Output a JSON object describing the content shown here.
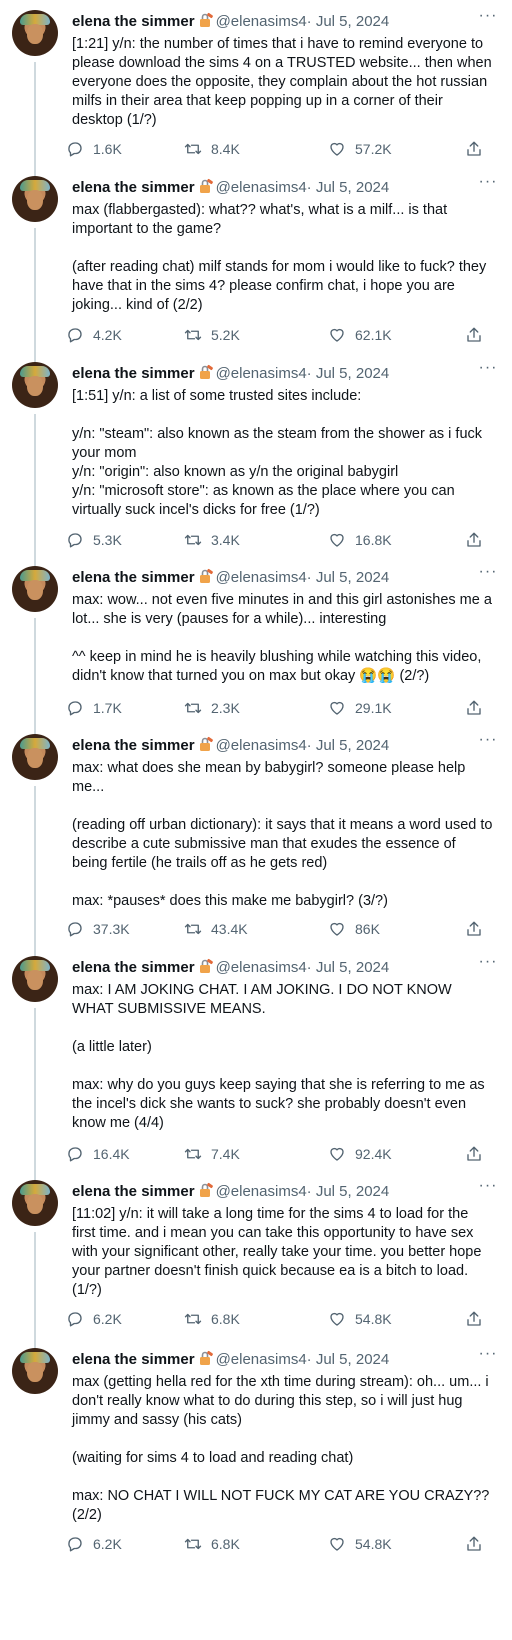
{
  "tweets": [
    {
      "name": "elena the simmer",
      "handle": "@elenasims4",
      "date": "· Jul 5, 2024",
      "text": "[1:21] y/n: the number of times that i have to remind everyone to please download the sims 4 on a TRUSTED website... then when everyone does the opposite, they complain about the hot russian milfs in their area that keep popping up in a corner of their desktop (1/?)",
      "replies": "1.6K",
      "retweets": "8.4K",
      "likes": "57.2K"
    },
    {
      "name": "elena the simmer",
      "handle": "@elenasims4",
      "date": "· Jul 5, 2024",
      "text": "max (flabbergasted): what?? what's, what is a milf... is that important to the game?\n\n(after reading chat) milf stands for mom i would like to fuck? they have that in the sims 4? please confirm chat, i hope you are joking... kind of (2/2)",
      "replies": "4.2K",
      "retweets": "5.2K",
      "likes": "62.1K"
    },
    {
      "name": "elena the simmer",
      "handle": "@elenasims4",
      "date": "· Jul 5, 2024",
      "text": "[1:51] y/n: a list of some trusted sites include:\n\ny/n: \"steam\": also known as the steam from the shower as i fuck your mom\ny/n: \"origin\": also known as y/n the original babygirl\ny/n: \"microsoft store\": as known as the place where you can virtually suck incel's dicks for free (1/?)",
      "replies": "5.3K",
      "retweets": "3.4K",
      "likes": "16.8K"
    },
    {
      "name": "elena the simmer",
      "handle": "@elenasims4",
      "date": "· Jul 5, 2024",
      "text": "max: wow... not even five minutes in and this girl astonishes me a lot... she is very (pauses for a while)... interesting\n\n^^ keep in mind he is heavily blushing while watching this video, didn't know that turned you on max but okay 😭😭 (2/?)",
      "replies": "1.7K",
      "retweets": "2.3K",
      "likes": "29.1K"
    },
    {
      "name": "elena the simmer",
      "handle": "@elenasims4",
      "date": "· Jul 5, 2024",
      "text": "max: what does she mean by babygirl? someone please help me...\n\n(reading off urban dictionary): it says that it means a word used to describe a cute submissive man that exudes the essence of being fertile (he trails off as he gets red)\n\nmax: *pauses* does this make me babygirl? (3/?)",
      "replies": "37.3K",
      "retweets": "43.4K",
      "likes": "86K"
    },
    {
      "name": "elena the simmer",
      "handle": "@elenasims4",
      "date": "· Jul 5, 2024",
      "text": "max: I AM JOKING CHAT. I AM JOKING. I DO NOT KNOW WHAT SUBMISSIVE MEANS.\n\n(a little later)\n\nmax: why do you guys keep saying that she is referring to me as the incel's dick she wants to suck? she probably doesn't even know me (4/4)",
      "replies": "16.4K",
      "retweets": "7.4K",
      "likes": "92.4K"
    },
    {
      "name": "elena the simmer",
      "handle": "@elenasims4",
      "date": "· Jul 5, 2024",
      "text": "[11:02] y/n: it will take a long time for the sims 4 to load for the first time. and i mean you can take this opportunity to have sex with your significant other, really take your time. you better hope your partner doesn't finish quick because ea is a bitch to load. (1/?)",
      "replies": "6.2K",
      "retweets": "6.8K",
      "likes": "54.8K"
    },
    {
      "name": "elena the simmer",
      "handle": "@elenasims4",
      "date": "· Jul 5, 2024",
      "text": "max (getting hella red for the xth time during stream): oh... um... i don't really know what to do during this step, so i will just hug jimmy and sassy (his cats)\n\n(waiting for sims 4 to load and reading chat)\n\nmax: NO CHAT I WILL NOT FUCK MY CAT ARE YOU CRAZY?? (2/2)",
      "replies": "6.2K",
      "retweets": "6.8K",
      "likes": "54.8K"
    }
  ],
  "icons": {
    "reply": "reply-icon",
    "retweet": "retweet-icon",
    "like": "heart-icon",
    "share": "share-icon",
    "lock": "lock-icon",
    "more": "more-icon"
  },
  "colors": {
    "text": "#0f1419",
    "secondary": "#536471",
    "thread_line": "#cfd9de"
  }
}
